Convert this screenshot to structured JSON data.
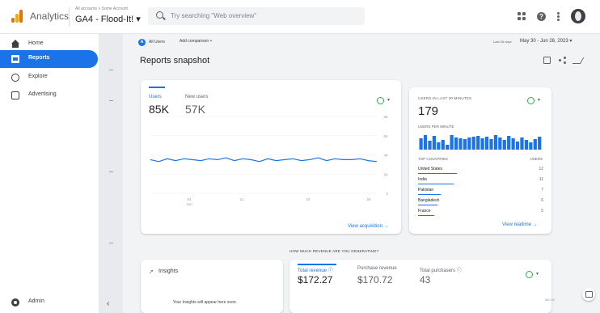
{
  "header": {
    "app_name": "Analytics",
    "account_path": "All accounts > Some Account",
    "property": "GA4 - Flood-It! ▾",
    "search_placeholder": "Try searching \"Web overview\"",
    "help_glyph": "?"
  },
  "sidebar": {
    "items": [
      {
        "label": "Home",
        "icon": "home-icon"
      },
      {
        "label": "Reports",
        "icon": "reports-icon"
      },
      {
        "label": "Explore",
        "icon": "explore-icon"
      },
      {
        "label": "Advertising",
        "icon": "advertising-icon"
      }
    ],
    "admin_label": "Admin",
    "collapse_glyph": "‹"
  },
  "toolbar": {
    "all_users_glyph": "A",
    "all_users_label": "All Users",
    "add_comparison": "Add comparison +",
    "date_prefix": "Last 28 days",
    "date_range": "May 30 - Jun 26, 2023 ▾"
  },
  "page": {
    "title": "Reports snapshot"
  },
  "overview_card": {
    "metrics": [
      {
        "label": "Users",
        "value": "85K"
      },
      {
        "label": "New users",
        "value": "57K"
      }
    ],
    "dropdown_glyph": "▾",
    "link": "View acquisition →"
  },
  "chart_data": {
    "type": "line",
    "title": "",
    "series": [
      {
        "name": "Users",
        "values": [
          3.5,
          3.3,
          3.6,
          3.4,
          3.6,
          3.5,
          3.4,
          3.6,
          3.5,
          3.7,
          3.4,
          3.6,
          3.5,
          3.3,
          3.6,
          3.4,
          3.5,
          3.6,
          3.4,
          3.5,
          3.7,
          3.4,
          3.6,
          3.5,
          3.5,
          3.6,
          3.4,
          3.3
        ]
      }
    ],
    "y_ticks": [
      "8K",
      "6K",
      "4K",
      "2K",
      "0"
    ],
    "x_ticks": [
      "04\nJun",
      "11",
      "18",
      "25"
    ],
    "ylim": [
      0,
      8
    ],
    "grid": true
  },
  "realtime": {
    "title": "USERS IN LAST 30 MINUTES",
    "value": "179",
    "subtitle": "USERS PER MINUTE",
    "bars": [
      14,
      18,
      11,
      17,
      9,
      12,
      6,
      18,
      15,
      14,
      13,
      15,
      16,
      17,
      14,
      16,
      13,
      18,
      15,
      12,
      17,
      14,
      10,
      15,
      12,
      9,
      13,
      16
    ],
    "bar_color": "#1a73e8",
    "col_country": "TOP COUNTRIES",
    "col_users": "USERS",
    "countries": [
      {
        "name": "United States",
        "users": "12",
        "share": 0.6
      },
      {
        "name": "India",
        "users": "11",
        "share": 0.55
      },
      {
        "name": "Pakistan",
        "users": "7",
        "share": 0.35
      },
      {
        "name": "Bangladesh",
        "users": "6",
        "share": 0.3
      },
      {
        "name": "France",
        "users": "5",
        "share": 0.25
      }
    ],
    "link": "View realtime →"
  },
  "revenue": {
    "question": "HOW MUCH REVENUE ARE YOU GENERATING?",
    "metrics": [
      {
        "label": "Total revenue ⓘ",
        "value": "$172.27"
      },
      {
        "label": "Purchase revenue",
        "value": "$170.72"
      },
      {
        "label": "Total purchasers ⓘ",
        "value": "43"
      }
    ],
    "axis_label": "$80.00"
  },
  "insights": {
    "icon_glyph": "↗",
    "label": "Insights",
    "empty_text": "Your Insights will appear here soon."
  },
  "colors": {
    "accent": "#1a73e8",
    "check": "#34a853"
  }
}
